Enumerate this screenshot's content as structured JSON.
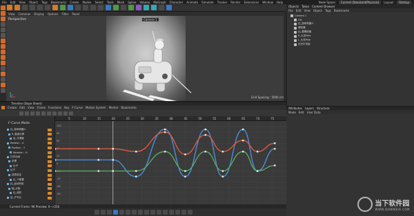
{
  "menubar": {
    "items": [
      "File",
      "Edit",
      "View",
      "Object",
      "Tags",
      "Bookmarks",
      "Create",
      "Modes",
      "Select",
      "Tools",
      "Mesh",
      "Spline",
      "Volume",
      "MoGraph",
      "Character",
      "Animate",
      "Simulate",
      "Tracker",
      "Render",
      "Extensions",
      "Window",
      "Help"
    ],
    "node_space_label": "Node Space:",
    "node_space_value": "Current (Standard/Physical)",
    "layout_label": "Layout:",
    "layout_value": "Startup"
  },
  "viewport": {
    "menu": [
      "View",
      "Cameras",
      "Display",
      "Options",
      "Filter",
      "Panel"
    ],
    "label": "Perspective",
    "camera": "Camera 1",
    "grid_spacing": "Grid Spacing : 5000 cm"
  },
  "objects_panel": {
    "tabs": [
      "Objects",
      "Takes",
      "Content Browser"
    ],
    "menu": [
      "File",
      "Edit",
      "View",
      "Object",
      "Tags",
      "Bookmarks"
    ],
    "rows": [
      "Camera 1",
      "Cie",
      "比_游戏机器人",
      "清除器",
      "比_雪橇底面",
      "R_大关Pole",
      "L_大关Pole",
      "比巴尔词诺"
    ]
  },
  "attributes_panel": {
    "tabs": [
      "Attributes",
      "Layers",
      "Structure"
    ],
    "menu": [
      "Mode",
      "Edit",
      "User Data"
    ]
  },
  "watermark": {
    "name": "当下软件园",
    "url": "WWW.DOWNXIA.COM"
  },
  "timeline": {
    "title": "Timeline (Dope Sheet)",
    "menu": [
      "Create",
      "Edit",
      "View",
      "Frame",
      "Functions",
      "Key",
      "F-Curve",
      "Motion System",
      "Marker",
      "Bookmarks"
    ],
    "mode": "F-Curve Mode",
    "ruler_ticks": [
      "5",
      "10",
      "15",
      "20",
      "25",
      "30",
      "35",
      "40",
      "45",
      "50",
      "55",
      "60",
      "65",
      "70",
      "75"
    ],
    "tracks": [
      {
        "label": "比_游戏机器人",
        "value": ""
      },
      {
        "label": "R_衰减计算",
        "value": ""
      },
      {
        "label": "后_平滑度",
        "value": ""
      },
      {
        "label": "Position . X",
        "value": ""
      },
      {
        "label": "Position . Y",
        "value": ""
      },
      {
        "label": "Rotation . H",
        "value": ""
      },
      {
        "label": "打开补间",
        "value": ""
      },
      {
        "label": "步骤",
        "value": ""
      },
      {
        "label": "比子",
        "value": ""
      },
      {
        "label": "比子",
        "value": ""
      },
      {
        "label": "选项设定",
        "value": ""
      },
      {
        "label": "比_十配置",
        "value": ""
      },
      {
        "label": "比_运动系统",
        "value": ""
      },
      {
        "label": "轴_父极",
        "value": ""
      },
      {
        "label": "比_组件",
        "value": ""
      },
      {
        "label": "后_子节点",
        "value": ""
      }
    ],
    "status": "Current Frame: 96  Preview: 0-->256",
    "y_ticks": [
      "100",
      "80",
      "60",
      "40",
      "20",
      "0",
      "-20",
      "-40",
      "-60",
      "-80"
    ]
  },
  "colors": {
    "accent_orange": "#d47a2a",
    "curve_blue": "#4a8fe0",
    "curve_red": "#e05a40",
    "curve_green": "#5aa860"
  },
  "chart_data": {
    "type": "line",
    "x": [
      0,
      15,
      20,
      28,
      38,
      45,
      52,
      58,
      65,
      70,
      76
    ],
    "series": [
      {
        "values": [
          40,
          40,
          40,
          10,
          95,
          10,
          95,
          10,
          95,
          20,
          60
        ],
        "color": "#4a8fe0"
      },
      {
        "values": [
          60,
          60,
          60,
          55,
          90,
          50,
          85,
          55,
          75,
          55,
          70
        ],
        "color": "#e05a40"
      },
      {
        "values": [
          20,
          20,
          20,
          20,
          55,
          20,
          55,
          20,
          55,
          20,
          30
        ],
        "color": "#5aa860"
      }
    ],
    "ylim": [
      -40,
      110
    ]
  }
}
